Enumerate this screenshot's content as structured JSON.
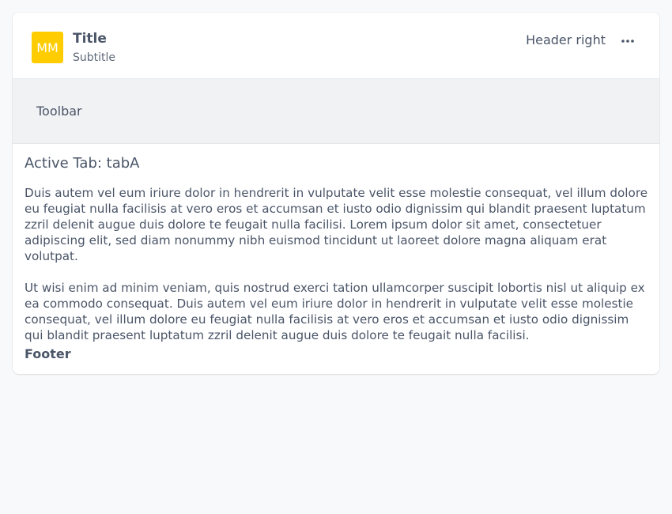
{
  "card": {
    "avatar": {
      "initials": "MM",
      "color": "#ffcc00"
    },
    "title": "Title",
    "subtitle": "Subtitle",
    "header_right": "Header right",
    "more_icon": "more-horizontal-icon",
    "toolbar_label": "Toolbar",
    "active_tab_prefix": "Active Tab: ",
    "active_tab": "tabA",
    "paragraphs": [
      "Duis autem vel eum iriure dolor in hendrerit in vulputate velit esse molestie consequat, vel illum dolore eu feugiat nulla facilisis at vero eros et accumsan et iusto odio dignissim qui blandit praesent luptatum zzril delenit augue duis dolore te feugait nulla facilisi. Lorem ipsum dolor sit amet, consectetuer adipiscing elit, sed diam nonummy nibh euismod tincidunt ut laoreet dolore magna aliquam erat volutpat.",
      "Ut wisi enim ad minim veniam, quis nostrud exerci tation ullamcorper suscipit lobortis nisl ut aliquip ex ea commodo consequat. Duis autem vel eum iriure dolor in hendrerit in vulputate velit esse molestie consequat, vel illum dolore eu feugiat nulla facilisis at vero eros et accumsan et iusto odio dignissim qui blandit praesent luptatum zzril delenit augue duis dolore te feugait nulla facilisi."
    ],
    "footer": "Footer"
  }
}
